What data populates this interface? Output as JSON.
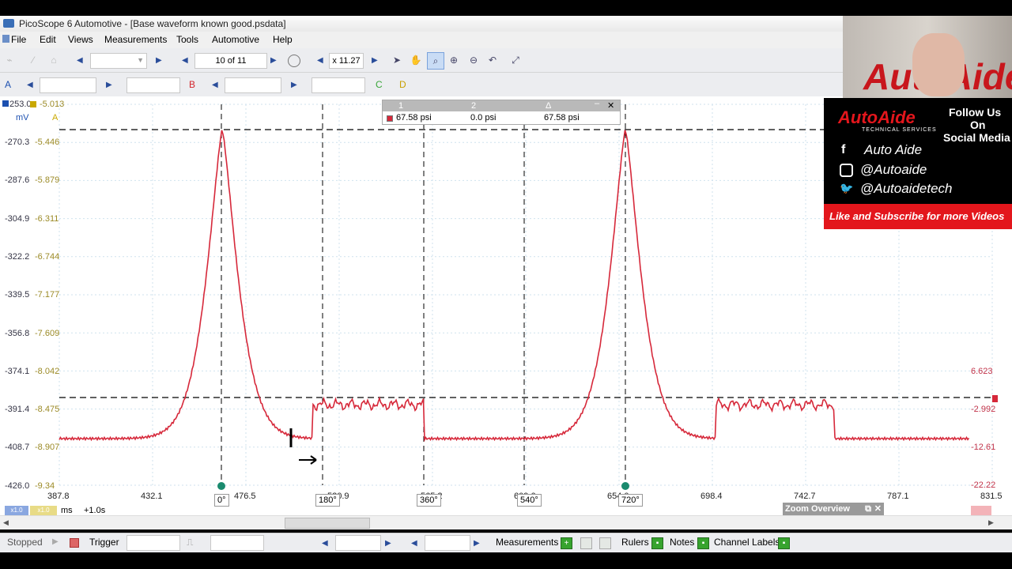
{
  "window": {
    "title": "PicoScope 6 Automotive - [Base waveform known good.psdata]"
  },
  "menu": [
    "File",
    "Edit",
    "Views",
    "Measurements",
    "Tools",
    "Automotive",
    "Help"
  ],
  "toolbar": {
    "capture_counter": "10 of 11",
    "zoom_level": "x 11.27"
  },
  "channels": {
    "a": "A",
    "b": "B",
    "c": "C",
    "d": "D"
  },
  "axis": {
    "top_left_a": "253.0",
    "top_left_b": "-5.013",
    "unit_a": "mV",
    "unit_b": "A",
    "y_a": [
      "-270.3",
      "-287.6",
      "-304.9",
      "-322.2",
      "-339.5",
      "-356.8",
      "-374.1",
      "-391.4",
      "-408.7",
      "-426.0"
    ],
    "y_b": [
      "-5.446",
      "-5.879",
      "-6.311",
      "-6.744",
      "-7.177",
      "-7.609",
      "-8.042",
      "-8.475",
      "-8.907",
      "-9.34"
    ],
    "y_right": [
      "6.623",
      "-2.992",
      "-12.61",
      "-22.22"
    ],
    "x": [
      "387.8",
      "432.1",
      "476.5",
      "520.9",
      "565.2",
      "609.6",
      "654.0",
      "698.4",
      "742.7",
      "787.1",
      "831.5"
    ],
    "x_unit": "ms",
    "x_offset": "+1.0s",
    "phase_markers": [
      "0°",
      "180°",
      "360°",
      "540°",
      "720°"
    ],
    "scale_badge_a": "x1.0",
    "scale_badge_b": "x1.0"
  },
  "ruler_panel": {
    "col1": "1",
    "col2": "2",
    "col3": "Δ",
    "v1": "67.58 psi",
    "v2": "0.0 psi",
    "v3": "67.58 psi"
  },
  "zoom_overview": "Zoom Overview",
  "social": {
    "brand": "AutoAide",
    "brand_sub": "TECHNICAL SERVICES",
    "follow": "Follow Us",
    "on": "On",
    "media": "Social Media",
    "facebook": "Auto Aide",
    "instagram": "@Autoaide",
    "twitter": "@Autoaidetech",
    "cta": "Like and Subscribe for more Videos"
  },
  "status": {
    "state": "Stopped",
    "trigger": "Trigger",
    "measurements": "Measurements",
    "rulers": "Rulers",
    "notes": "Notes",
    "channel_labels": "Channel Labels"
  },
  "colors": {
    "trace": "#d6283a",
    "social_red": "#e3161c",
    "accent": "#1c50b0"
  }
}
